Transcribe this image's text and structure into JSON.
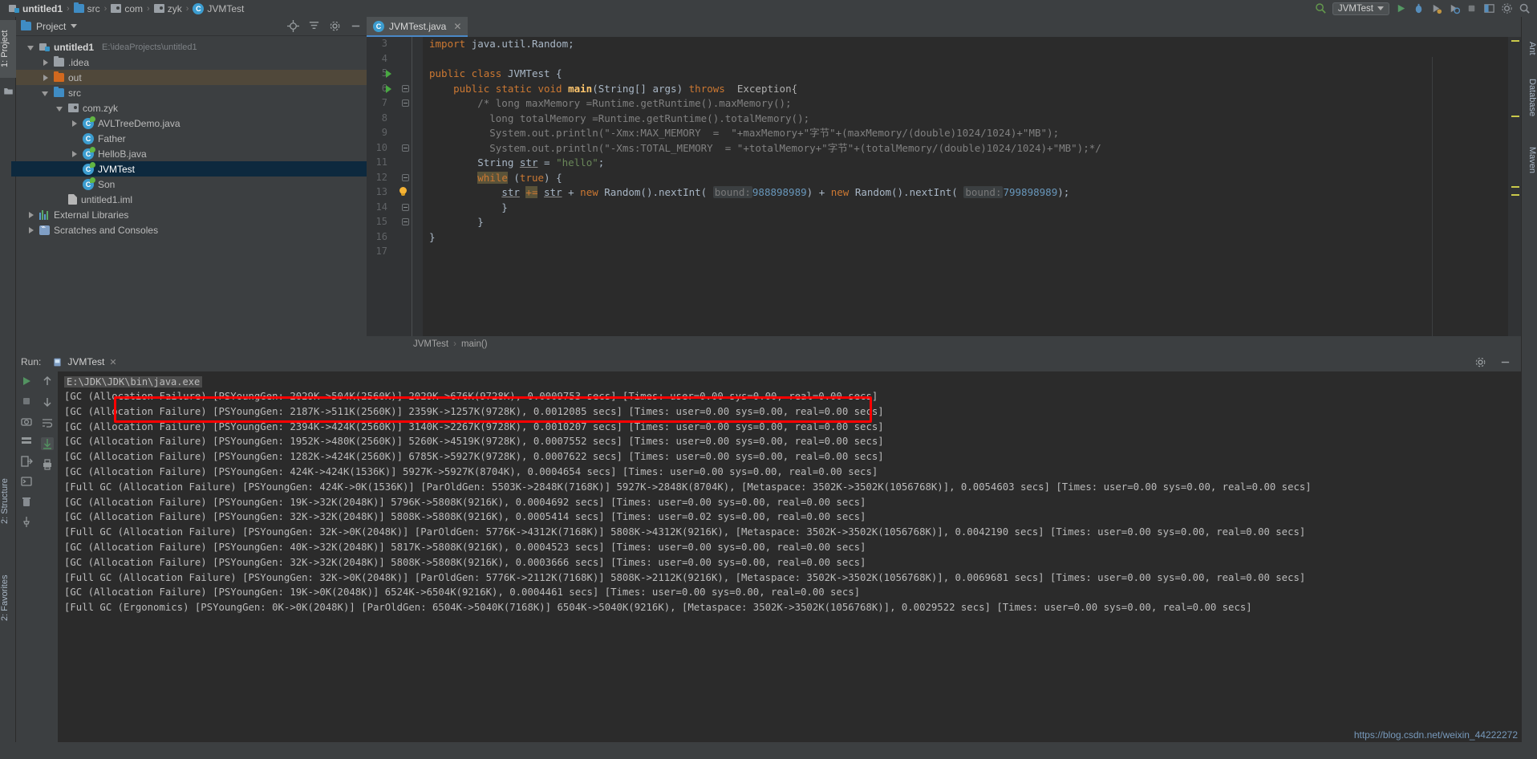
{
  "navbar": {
    "breadcrumbs": [
      {
        "label": "untitled1",
        "icon": "module-icon",
        "bold": true
      },
      {
        "label": "src",
        "icon": "folder-icon"
      },
      {
        "label": "com",
        "icon": "package-icon"
      },
      {
        "label": "zyk",
        "icon": "package-icon"
      },
      {
        "label": "JVMTest",
        "icon": "class-icon"
      }
    ],
    "separator": "›",
    "run_config": "JVMTest",
    "right_icons": [
      "search-icon",
      "run-config-dropdown",
      "run-icon",
      "debug-icon",
      "coverage-icon",
      "profile-icon",
      "stop-icon",
      "layout-icon",
      "settings-icon",
      "search-everywhere-icon"
    ]
  },
  "left_strip": {
    "tabs": [
      {
        "label": "1: Project",
        "active": true
      },
      {
        "label": "2: Structure",
        "active": false
      },
      {
        "label": "2: Favorites",
        "active": false
      }
    ]
  },
  "right_strip": {
    "tabs": [
      {
        "label": "Ant",
        "active": false
      },
      {
        "label": "Database",
        "active": false
      },
      {
        "label": "Maven",
        "active": false
      }
    ]
  },
  "project_panel": {
    "title": "Project",
    "actions": [
      "locate-icon",
      "collapse-all-icon",
      "settings-icon",
      "minimize-icon",
      "hide-icon"
    ],
    "tree": [
      {
        "label": "untitled1",
        "path": "E:\\ideaProjects\\untitled1",
        "icon": "module-icon",
        "depth": 0,
        "arrow": "down",
        "bold": true,
        "state": "normal"
      },
      {
        "label": ".idea",
        "path": "",
        "icon": "folder-icon",
        "depth": 1,
        "arrow": "right",
        "bold": false,
        "state": "normal"
      },
      {
        "label": "out",
        "path": "",
        "icon": "folder-out-icon",
        "depth": 1,
        "arrow": "right",
        "bold": false,
        "state": "highlight"
      },
      {
        "label": "src",
        "path": "",
        "icon": "folder-src-icon",
        "depth": 1,
        "arrow": "down",
        "bold": false,
        "state": "normal"
      },
      {
        "label": "com.zyk",
        "path": "",
        "icon": "package-icon",
        "depth": 2,
        "arrow": "down",
        "bold": false,
        "state": "normal"
      },
      {
        "label": "AVLTreeDemo.java",
        "path": "",
        "icon": "class-runnable-icon",
        "depth": 3,
        "arrow": "right",
        "bold": false,
        "state": "normal"
      },
      {
        "label": "Father",
        "path": "",
        "icon": "class-icon",
        "depth": 3,
        "arrow": "none",
        "bold": false,
        "state": "normal"
      },
      {
        "label": "HelloB.java",
        "path": "",
        "icon": "class-runnable-icon",
        "depth": 3,
        "arrow": "right",
        "bold": false,
        "state": "normal"
      },
      {
        "label": "JVMTest",
        "path": "",
        "icon": "class-runnable-icon",
        "depth": 3,
        "arrow": "none",
        "bold": false,
        "state": "selected"
      },
      {
        "label": "Son",
        "path": "",
        "icon": "class-runnable-icon",
        "depth": 3,
        "arrow": "none",
        "bold": false,
        "state": "normal"
      },
      {
        "label": "untitled1.iml",
        "path": "",
        "icon": "file-icon",
        "depth": 2,
        "arrow": "none",
        "bold": false,
        "state": "normal"
      },
      {
        "label": "External Libraries",
        "path": "",
        "icon": "library-icon",
        "depth": 0,
        "arrow": "right",
        "bold": false,
        "state": "normal"
      },
      {
        "label": "Scratches and Consoles",
        "path": "",
        "icon": "scratch-icon",
        "depth": 0,
        "arrow": "right",
        "bold": false,
        "state": "normal"
      }
    ]
  },
  "editor": {
    "tab": {
      "label": "JVMTest.java",
      "icon": "class-icon",
      "close": "✕"
    },
    "breadcrumb": [
      "JVMTest",
      "main()"
    ],
    "breadcrumb_sep": "›",
    "first_line_number": 3,
    "lines": [
      {
        "n": 3,
        "run": false,
        "fold": false,
        "bulb": false
      },
      {
        "n": 4,
        "run": false,
        "fold": false,
        "bulb": false
      },
      {
        "n": 5,
        "run": true,
        "fold": false,
        "bulb": false
      },
      {
        "n": 6,
        "run": true,
        "fold": true,
        "bulb": false
      },
      {
        "n": 7,
        "run": false,
        "fold": true,
        "bulb": false
      },
      {
        "n": 8,
        "run": false,
        "fold": false,
        "bulb": false
      },
      {
        "n": 9,
        "run": false,
        "fold": false,
        "bulb": false
      },
      {
        "n": 10,
        "run": false,
        "fold": true,
        "bulb": false
      },
      {
        "n": 11,
        "run": false,
        "fold": false,
        "bulb": false
      },
      {
        "n": 12,
        "run": false,
        "fold": true,
        "bulb": false
      },
      {
        "n": 13,
        "run": false,
        "fold": false,
        "bulb": true
      },
      {
        "n": 14,
        "run": false,
        "fold": true,
        "bulb": false
      },
      {
        "n": 15,
        "run": false,
        "fold": true,
        "bulb": false
      },
      {
        "n": 16,
        "run": false,
        "fold": false,
        "bulb": false
      },
      {
        "n": 17,
        "run": false,
        "fold": false,
        "bulb": false
      }
    ],
    "code_text": [
      "import java.util.Random;",
      "",
      "public class JVMTest {",
      "    public static void main(String[] args) throws  Exception{",
      "        /* long maxMemory =Runtime.getRuntime().maxMemory();",
      "          long totalMemory =Runtime.getRuntime().totalMemory();",
      "          System.out.println(\"-Xmx:MAX_MEMORY  =  \"+maxMemory+\"字节\"+(maxMemory/(double)1024/1024)+\"MB\");",
      "          System.out.println(\"-Xms:TOTAL_MEMORY  = \"+totalMemory+\"字节\"+(totalMemory/(double)1024/1024)+\"MB\");*/",
      "        String str = \"hello\";",
      "        while (true) {",
      "            str += str + new Random().nextInt( bound: 988898989) + new Random().nextInt( bound: 799898989);",
      "        }",
      "      }",
      "}",
      ""
    ],
    "hint_label": "bound:",
    "bound1": "988898989",
    "bound2": "799898989"
  },
  "run_panel": {
    "run_label": "Run:",
    "tab_label": "JVMTest",
    "tab_close": "✕",
    "actions": [
      "settings-icon",
      "minimize-icon"
    ],
    "toolbar_left": [
      "rerun-icon",
      "stop-icon",
      "camera-icon",
      "dump-icon",
      "exit-icon",
      "console-icon",
      "trash-icon",
      "pin-icon"
    ],
    "toolbar_mid": [
      "up-arrow-icon",
      "down-arrow-icon",
      "wrap-icon",
      "scroll-end-icon",
      "print-icon"
    ],
    "command_line": "E:\\JDK\\JDK\\bin\\java.exe",
    "log_lines": [
      "[GC (Allocation Failure) [PSYoungGen: 2029K->504K(2560K)] 2029K->676K(9728K), 0.0009753 secs] [Times: user=0.00 sys=0.00, real=0.00 secs]",
      "[GC (Allocation Failure) [PSYoungGen: 2187K->511K(2560K)] 2359K->1257K(9728K), 0.0012085 secs] [Times: user=0.00 sys=0.00, real=0.00 secs]",
      "[GC (Allocation Failure) [PSYoungGen: 2394K->424K(2560K)] 3140K->2267K(9728K), 0.0010207 secs] [Times: user=0.00 sys=0.00, real=0.00 secs]",
      "[GC (Allocation Failure) [PSYoungGen: 1952K->480K(2560K)] 5260K->4519K(9728K), 0.0007552 secs] [Times: user=0.00 sys=0.00, real=0.00 secs]",
      "[GC (Allocation Failure) [PSYoungGen: 1282K->424K(2560K)] 6785K->5927K(9728K), 0.0007622 secs] [Times: user=0.00 sys=0.00, real=0.00 secs]",
      "[GC (Allocation Failure) [PSYoungGen: 424K->424K(1536K)] 5927K->5927K(8704K), 0.0004654 secs] [Times: user=0.00 sys=0.00, real=0.00 secs]",
      "[Full GC (Allocation Failure) [PSYoungGen: 424K->0K(1536K)] [ParOldGen: 5503K->2848K(7168K)] 5927K->2848K(8704K), [Metaspace: 3502K->3502K(1056768K)], 0.0054603 secs] [Times: user=0.00 sys=0.00, real=0.00 secs]",
      "[GC (Allocation Failure) [PSYoungGen: 19K->32K(2048K)] 5796K->5808K(9216K), 0.0004692 secs] [Times: user=0.00 sys=0.00, real=0.00 secs]",
      "[GC (Allocation Failure) [PSYoungGen: 32K->32K(2048K)] 5808K->5808K(9216K), 0.0005414 secs] [Times: user=0.02 sys=0.00, real=0.00 secs]",
      "[Full GC (Allocation Failure) [PSYoungGen: 32K->0K(2048K)] [ParOldGen: 5776K->4312K(7168K)] 5808K->4312K(9216K), [Metaspace: 3502K->3502K(1056768K)], 0.0042190 secs] [Times: user=0.00 sys=0.00, real=0.00 secs]",
      "[GC (Allocation Failure) [PSYoungGen: 40K->32K(2048K)] 5817K->5808K(9216K), 0.0004523 secs] [Times: user=0.00 sys=0.00, real=0.00 secs]",
      "[GC (Allocation Failure) [PSYoungGen: 32K->32K(2048K)] 5808K->5808K(9216K), 0.0003666 secs] [Times: user=0.00 sys=0.00, real=0.00 secs]",
      "[Full GC (Allocation Failure) [PSYoungGen: 32K->0K(2048K)] [ParOldGen: 5776K->2112K(7168K)] 5808K->2112K(9216K), [Metaspace: 3502K->3502K(1056768K)], 0.0069681 secs] [Times: user=0.00 sys=0.00, real=0.00 secs]",
      "[GC (Allocation Failure) [PSYoungGen: 19K->0K(2048K)] 6524K->6504K(9216K), 0.0004461 secs] [Times: user=0.00 sys=0.00, real=0.00 secs]",
      "[Full GC (Ergonomics) [PSYoungGen: 0K->0K(2048K)] [ParOldGen: 6504K->5040K(7168K)] 6504K->5040K(9216K), [Metaspace: 3502K->3502K(1056768K)], 0.0029522 secs] [Times: user=0.00 sys=0.00, real=0.00 secs]"
    ],
    "highlight_line_index": 0,
    "highlight_color": "#ff0000"
  },
  "watermark": "https://blog.csdn.net/weixin_44222272",
  "colors": {
    "panel_bg": "#3c3f41",
    "editor_bg": "#2b2b2b",
    "gutter_bg": "#313335",
    "selection": "#0d293e",
    "accent": "#4a88c7",
    "keyword": "#cc7832",
    "string": "#6a8759",
    "number": "#6897bb",
    "comment": "#808080"
  }
}
